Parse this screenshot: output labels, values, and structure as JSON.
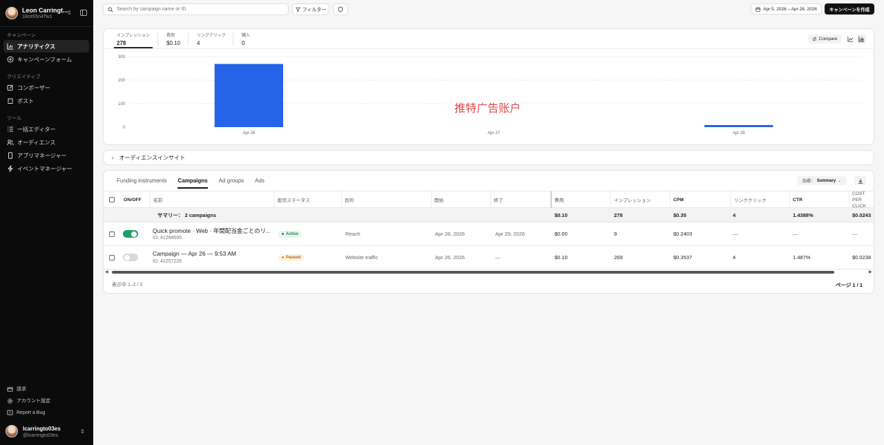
{
  "account": {
    "name": "Leon Carringt...",
    "id": "18ce55n4Tw1"
  },
  "sidebar": {
    "section_campaign": "キャンペーン",
    "section_creative": "クリエイティブ",
    "section_tools": "ツール",
    "items": [
      {
        "label": "アナリティクス",
        "icon": "analytics-icon"
      },
      {
        "label": "キャンペーンフォーム",
        "icon": "plus-circle-icon"
      },
      {
        "label": "コンポーザー",
        "icon": "edit-icon"
      },
      {
        "label": "ポスト",
        "icon": "post-icon"
      },
      {
        "label": "一括エディター",
        "icon": "list-icon"
      },
      {
        "label": "オーディエンス",
        "icon": "users-icon"
      },
      {
        "label": "アプリマネージャー",
        "icon": "phone-icon"
      },
      {
        "label": "イベントマネージャー",
        "icon": "bolt-icon"
      }
    ],
    "bottom": [
      {
        "label": "請求",
        "icon": "billing-icon"
      },
      {
        "label": "アカウント設定",
        "icon": "gear-icon"
      },
      {
        "label": "Report a Bug",
        "icon": "bug-icon"
      }
    ]
  },
  "user": {
    "name": "lcarringto03es",
    "handle": "@lcarringto03es"
  },
  "topbar": {
    "search_placeholder": "Search by campaign name or ID",
    "filter_label": "フィルター",
    "date_range": "Apr 5, 2026 – Apr 28, 2026",
    "create_label": "キャンペーンを作成"
  },
  "metrics": [
    {
      "label": "インプレッション",
      "value": "278"
    },
    {
      "label": "費用",
      "value": "$0.10"
    },
    {
      "label": "リンククリック",
      "value": "4"
    },
    {
      "label": "購入",
      "value": "0"
    }
  ],
  "compare_label": "Compare",
  "watermark": "推特广告账户",
  "chart_data": {
    "type": "bar",
    "categories": [
      "Apr 26",
      "Apr 27",
      "Apr 28"
    ],
    "values": [
      269,
      0,
      9
    ],
    "yticks": [
      "0",
      "100",
      "200",
      "300"
    ],
    "ylim": [
      0,
      300
    ],
    "grid": true,
    "color": "#2563e8"
  },
  "audience_label": "オーディエンスインサイト",
  "tabs": [
    "Funding instruments",
    "Campaigns",
    "Ad groups",
    "Ads"
  ],
  "breakdown": {
    "prefix": "指標：",
    "value": "Summary"
  },
  "table": {
    "headers": {
      "onoff": "ON/OFF",
      "name": "名前",
      "status": "配信ステータス",
      "objective": "目的",
      "start": "開始",
      "end": "終了",
      "spend": "費用",
      "impressions": "インプレッション",
      "cpm": "CPM",
      "clicks": "リンククリック",
      "ctr": "CTR",
      "cpc": "COST PER CLICK"
    },
    "summary": {
      "label": "サマリー： 2 campaigns",
      "spend": "$0.10",
      "impressions": "278",
      "cpm": "$0.35",
      "clicks": "4",
      "ctr": "1.4388%",
      "cpc": "$0.0243"
    },
    "rows": [
      {
        "name": "Quick promote · Web · 年間配当金ごとのリ...",
        "id": "ID: 41268595",
        "status": "Active",
        "objective": "Reach",
        "start": "Apr 28, 2026",
        "end": "Apr 29, 2026",
        "spend": "$0.00",
        "impressions": "9",
        "cpm": "$0.2403",
        "clicks": "—",
        "ctr": "—",
        "cpc": "—"
      },
      {
        "name": "Campaign — Apr 26 — 9:53 AM",
        "id": "ID: 41257226",
        "status": "Paused",
        "objective": "Website traffic",
        "start": "Apr 26, 2026",
        "end": "—",
        "spend": "$0.10",
        "impressions": "269",
        "cpm": "$0.3537",
        "clicks": "4",
        "ctr": "1.487%",
        "cpc": "$0.0238"
      }
    ]
  },
  "footer": {
    "showing": "表示中 1–2 / 2",
    "page": "ページ 1 / 1"
  }
}
